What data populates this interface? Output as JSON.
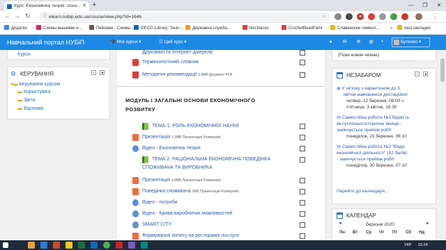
{
  "browser": {
    "tab_title": "Курс: Економічна теорія: осно...",
    "url": "elearn.nubip.edu.ua/course/view.php?id=1646",
    "bookmarks": [
      "Додатки",
      "Схемы вышивки и...",
      "Пейзажи - Схемы...",
      "OECD iLibrary: Sear...",
      "Державна служба...",
      "Necklaces",
      "CrochetBeadPaint",
      "Славянские символ..."
    ],
    "other_bookmarks": "Інші закладки"
  },
  "header": {
    "site_title": "Навчальний портал НУБіП",
    "my_courses": "Мої курси",
    "this_course": "Цей курс",
    "user_name": "Бутенко"
  },
  "left": {
    "courses_link": "Курси",
    "admin_title": "КЕРУВАННЯ",
    "course_admin": "Керування курсом",
    "items": [
      "Користувачі",
      "Звіти",
      "Відзнаки"
    ]
  },
  "main": {
    "top_items": [
      {
        "text": "Друковані та Інтернет-джерела",
        "meta": ""
      },
      {
        "text": "Термінологічний словник",
        "meta": ""
      },
      {
        "text": "Методичні рекомендації",
        "meta": "3.4МБ Документ PDF"
      }
    ],
    "module_title_line1": "МОДУЛЬ І ЗАГАЛЬНІ ОСНОВИ ЕКОНОМІЧНОГО",
    "module_title_line2": "РОЗВИТКУ",
    "items": [
      {
        "text": "ТЕМА 1. РОЛЬ ЕКОНОМІЧНОЇ НАУКИ",
        "meta": "",
        "icon": "book-icon"
      },
      {
        "text": "Презентація",
        "meta": "1.1МБ Презентація Powerpoint",
        "icon": "powerpoint-icon"
      },
      {
        "text": "Відео - Економічна теорія",
        "meta": "",
        "icon": "url-icon"
      },
      {
        "text": "ТЕМА 2. РАЦІОНАЛЬНА ЕКОНОМІЧНА ПОВЕДІНКА",
        "text2": "СПОЖИВАЧА ТА ВИРОБНИКА",
        "meta": "",
        "icon": "book-icon"
      },
      {
        "text": "Презентація",
        "meta": "3.8МБ Презентація Powerpoint",
        "icon": "powerpoint-icon"
      },
      {
        "text": "Поведінка споживача",
        "meta": "1МБ Презентація Powerpoint",
        "icon": "powerpoint-icon"
      },
      {
        "text": "Відео - потреби",
        "meta": "",
        "icon": "url-icon"
      },
      {
        "text": "Відео - Крива виробничих можливостей",
        "meta": "",
        "icon": "url-icon"
      },
      {
        "text": "SMART CITY",
        "meta": "",
        "icon": "url-icon"
      },
      {
        "text": "Формування попиту на ресторанні послуги",
        "meta": "",
        "icon": "powerpoint-icon"
      }
    ]
  },
  "right": {
    "news_none": "(Поки новин немає)",
    "upcoming_title": "НЕЗАБАРОМ",
    "events": [
      {
        "lines": [
          "У зв'язку з карантином до 3",
          "квітня навчаємося дистаційно!"
        ],
        "date_lines": [
          "четвер, 12 березня, 08:00 »",
          "п'ятниця, 3 квітня, 16:30"
        ]
      },
      {
        "lines": [
          "Самостійна робота №1 Відність",
          "як суспільно-історичне явище -",
          "закінчується прийом робіт"
        ],
        "date_lines": [
          "понеділок, 23 березня, 06:10"
        ]
      },
      {
        "lines": [
          "Самостійна робота №2 \"Види",
          "економічної діяльності\" (12 балів)",
          "- закінчується прийом робіт"
        ],
        "date_lines": [
          "понеділок, 30 березня, 07:10"
        ]
      }
    ],
    "go_calendar": "Перейти до календаря...",
    "calendar_title": "КАЛЕНДАР",
    "month": "березня 2020",
    "weekdays": [
      "Пн",
      "Вт",
      "Ср",
      "Чт",
      "Пт",
      "Сб",
      "Нд"
    ]
  },
  "taskbar": {
    "lang": "УКР",
    "time": "15:24"
  }
}
